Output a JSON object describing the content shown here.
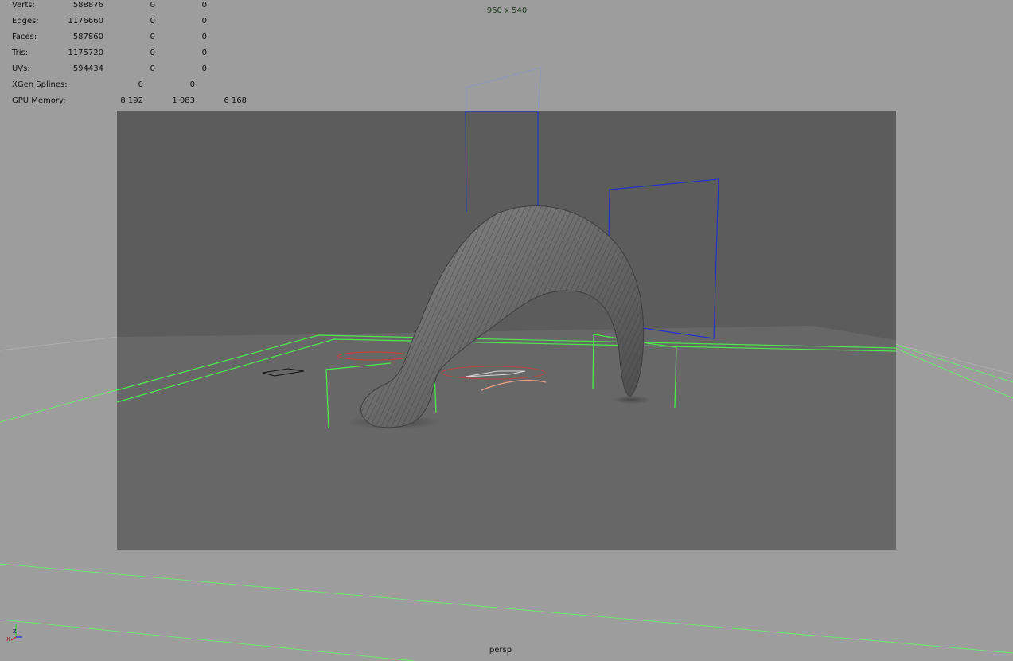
{
  "hud": {
    "rows": [
      {
        "label": "Verts:",
        "v1": "588876",
        "v2": "0",
        "v3": "0"
      },
      {
        "label": "Edges:",
        "v1": "1176660",
        "v2": "0",
        "v3": "0"
      },
      {
        "label": "Faces:",
        "v1": "587860",
        "v2": "0",
        "v3": "0"
      },
      {
        "label": "Tris:",
        "v1": "1175720",
        "v2": "0",
        "v3": "0"
      },
      {
        "label": "UVs:",
        "v1": "594434",
        "v2": "0",
        "v3": "0"
      },
      {
        "label": "XGen Splines:",
        "v1": "0",
        "v2": "0"
      },
      {
        "label": "GPU Memory:",
        "v1": "8 192",
        "v2": "1 083",
        "v3": "6 168"
      }
    ]
  },
  "viewport": {
    "resolution_gate": "960 x 540",
    "camera": "persp",
    "axis_labels": {
      "y": "Y",
      "z": "Z",
      "x": "X"
    }
  },
  "colors": {
    "bg_outer": "#9d9d9d",
    "gate_bg": "#676767",
    "gate_wall": "#5c5c5c",
    "grid_green": "#5ff05f",
    "bbox_blue": "#2233cc",
    "curve_red": "#c0443a",
    "curve_orange": "#e8a082",
    "worm": "#6a6a6a"
  },
  "icons": [
    "axis-indicator-icon"
  ]
}
